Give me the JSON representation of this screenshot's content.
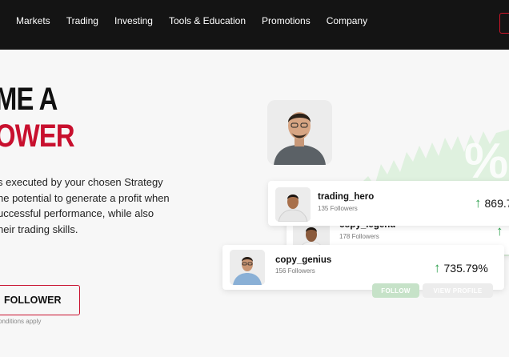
{
  "nav": {
    "items": [
      "Markets",
      "Trading",
      "Investing",
      "Tools & Education",
      "Promotions",
      "Company"
    ]
  },
  "hero": {
    "line1": "ME A",
    "line2": "OWER",
    "body_lines": [
      "s executed by your chosen Strategy",
      "he potential to generate a profit when",
      "uccessful performance, while also",
      "heir trading skills."
    ],
    "cta_label": "FOLLOWER",
    "terms": "onditions apply"
  },
  "traders": [
    {
      "name": "trading_hero",
      "followers": "135 Followers",
      "return": "869.7"
    },
    {
      "name": "copy_legend",
      "followers": "178 Followers",
      "return": ""
    },
    {
      "name": "copy_genius",
      "followers": "156 Followers",
      "return": "735.79%"
    }
  ],
  "actions": {
    "follow": "FOLLOW",
    "view_profile": "VIEW PROFILE"
  },
  "colors": {
    "brand_red": "#c8102e",
    "topbar": "#141414",
    "gain_green": "#2fa14e"
  },
  "icons": {
    "gain": "arrow-up-icon"
  }
}
